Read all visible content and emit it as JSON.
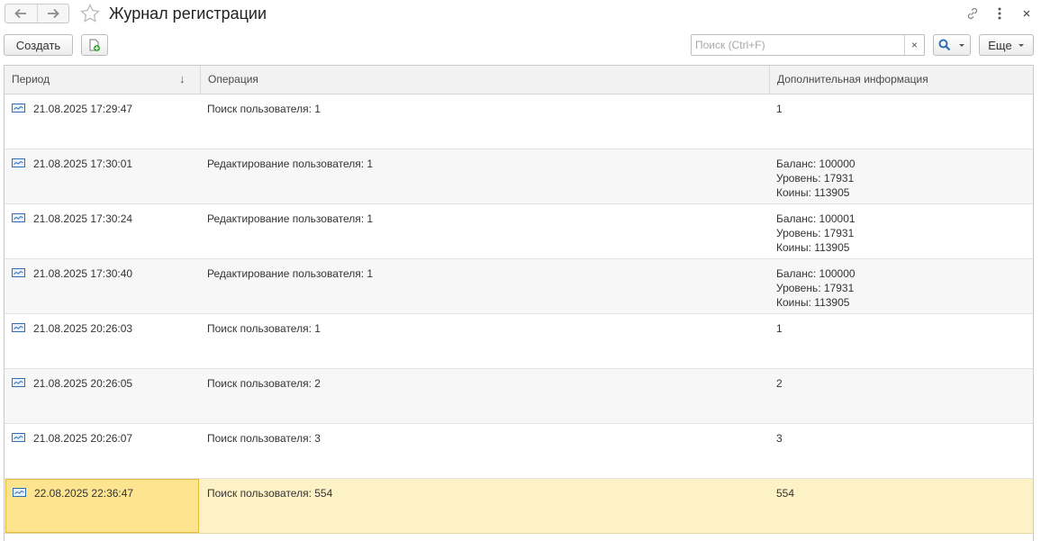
{
  "window": {
    "title": "Журнал регистрации"
  },
  "toolbar": {
    "create_label": "Создать",
    "more_label": "Еще",
    "search_placeholder": "Поиск (Ctrl+F)",
    "search_value": "",
    "clear_label": "×"
  },
  "icons": {
    "back": "arrow-left-icon",
    "forward": "arrow-right-icon",
    "favorite": "star-icon",
    "link": "link-icon",
    "menu": "more-vertical-icon",
    "close": "close-icon",
    "report": "report-add-icon",
    "search": "search-icon",
    "row": "log-record-icon"
  },
  "colors": {
    "selected_row": "#fdf1c6",
    "selected_cell": "#fde590",
    "selected_border": "#e5b93c",
    "header_bg": "#f2f2f2",
    "accent_blue": "#2d6fb5"
  },
  "table": {
    "columns": [
      "Период",
      "Операция",
      "Дополнительная информация"
    ],
    "sort_indicator": "↓",
    "rows": [
      {
        "period": "21.08.2025 17:29:47",
        "operation": "Поиск пользователя: 1",
        "info": [
          "1"
        ]
      },
      {
        "period": "21.08.2025 17:30:01",
        "operation": "Редактирование пользователя: 1",
        "info": [
          "Баланс: 100000",
          "Уровень: 17931",
          "Коины: 113905"
        ]
      },
      {
        "period": "21.08.2025 17:30:24",
        "operation": "Редактирование пользователя: 1",
        "info": [
          "Баланс: 100001",
          "Уровень: 17931",
          "Коины: 113905"
        ]
      },
      {
        "period": "21.08.2025 17:30:40",
        "operation": "Редактирование пользователя: 1",
        "info": [
          "Баланс: 100000",
          "Уровень: 17931",
          "Коины: 113905"
        ]
      },
      {
        "period": "21.08.2025 20:26:03",
        "operation": "Поиск пользователя: 1",
        "info": [
          "1"
        ]
      },
      {
        "period": "21.08.2025 20:26:05",
        "operation": "Поиск пользователя: 2",
        "info": [
          "2"
        ]
      },
      {
        "period": "21.08.2025 20:26:07",
        "operation": "Поиск пользователя: 3",
        "info": [
          "3"
        ]
      },
      {
        "period": "22.08.2025 22:36:47",
        "operation": "Поиск пользователя: 554",
        "info": [
          "554"
        ],
        "selected": true
      }
    ]
  }
}
